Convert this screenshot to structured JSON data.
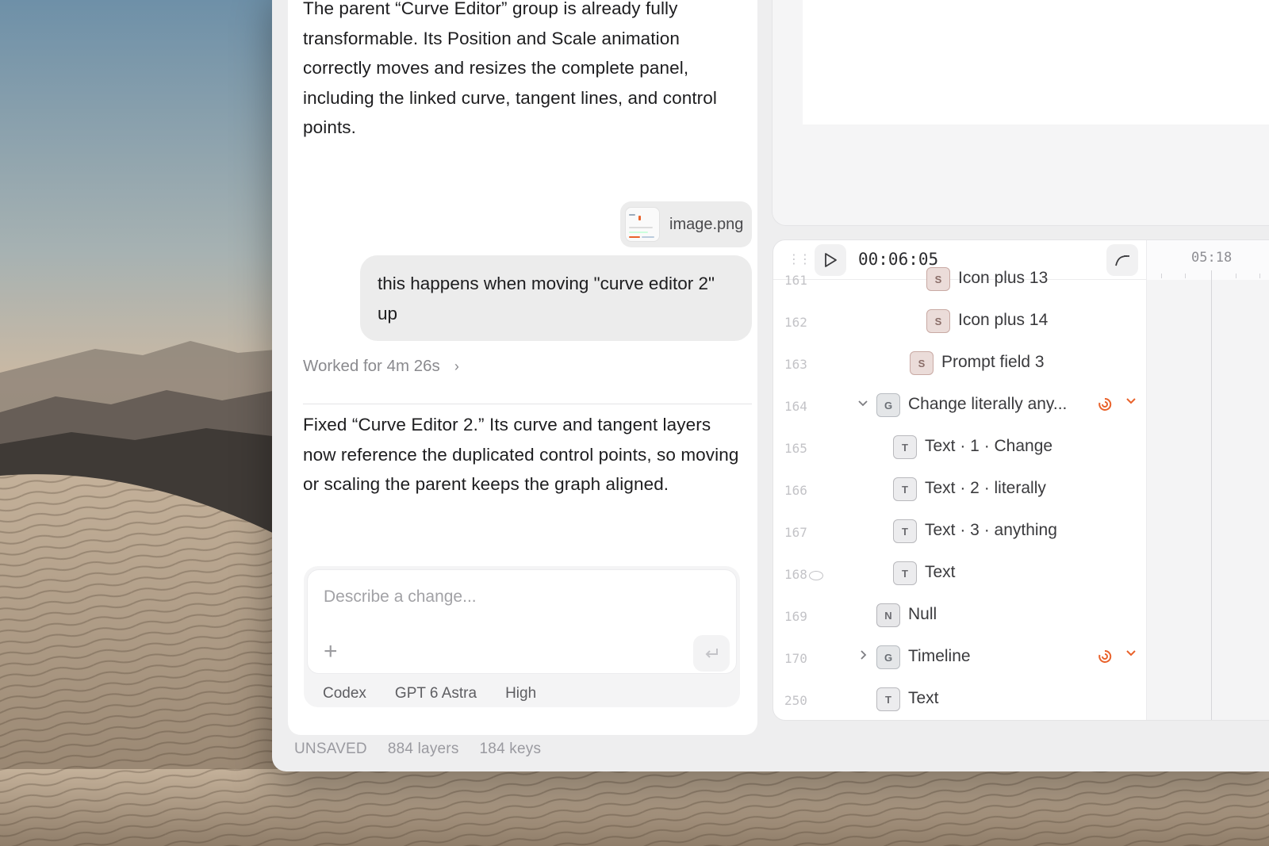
{
  "chat": {
    "message_1": "The parent “Curve Editor” group is already fully transformable. Its Position and Scale animation correctly moves and resizes the complete panel, including the linked curve, tangent lines, and control points.",
    "attachment_name": "image.png",
    "user_message": "this happens when moving \"curve editor 2\" up",
    "worked_for": "Worked for 4m 26s",
    "message_2": "Fixed “Curve Editor 2.” Its curve and tangent layers now reference the duplicated control points, so moving or scaling the parent keeps the graph aligned."
  },
  "composer": {
    "placeholder": "Describe a change...",
    "agent": "Codex",
    "model": "GPT 6 Astra",
    "effort": "High"
  },
  "status": {
    "state": "UNSAVED",
    "layers": "884 layers",
    "keys": "184 keys"
  },
  "timeline": {
    "timecode": "00:06:05",
    "ruler_mark": "05:18",
    "rows": [
      {
        "num": "161",
        "type": "S",
        "label": "Icon plus 13"
      },
      {
        "num": "162",
        "type": "S",
        "label": "Icon plus 14"
      },
      {
        "num": "163",
        "type": "S",
        "label": "Prompt field 3"
      },
      {
        "num": "164",
        "type": "G",
        "label": "Change literally any..."
      },
      {
        "num": "165",
        "type": "T",
        "label": "Text · 1 · Change"
      },
      {
        "num": "166",
        "type": "T",
        "label": "Text · 2 · literally"
      },
      {
        "num": "167",
        "type": "T",
        "label": "Text · 3 · anything"
      },
      {
        "num": "168",
        "type": "T",
        "label": "Text"
      },
      {
        "num": "169",
        "type": "N",
        "label": "Null"
      },
      {
        "num": "170",
        "type": "G",
        "label": "Timeline"
      },
      {
        "num": "250",
        "type": "T",
        "label": "Text"
      }
    ]
  },
  "colors": {
    "accent_orange": "#e9622b",
    "window_bg": "#eeeeef",
    "panel_bg": "#ffffff"
  },
  "icons": {
    "play": "play-icon",
    "curve": "curve-editor-icon",
    "add": "plus-icon",
    "send": "return-icon",
    "effects": "swirl-icon",
    "dropdown": "chevron-down-icon",
    "disclosure_open": "chevron-down-icon",
    "disclosure_closed": "chevron-right-icon",
    "visibility": "eye-icon",
    "grip": "drag-handle-icon"
  }
}
